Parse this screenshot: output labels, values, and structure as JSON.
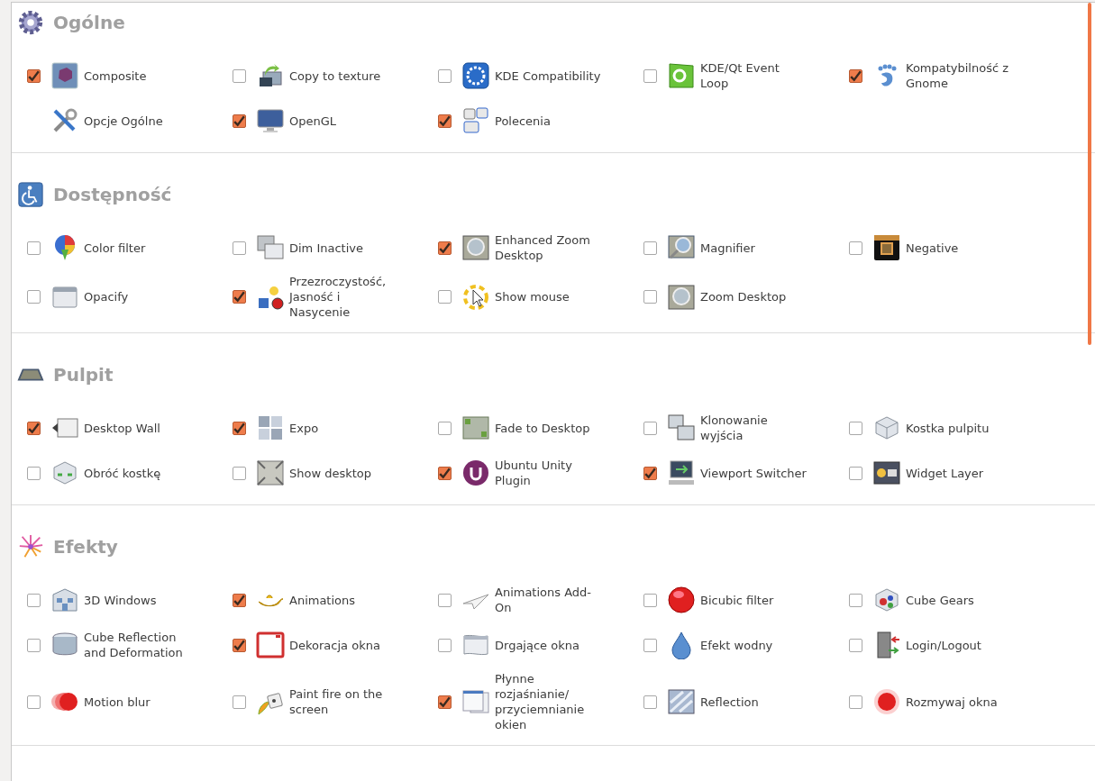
{
  "sections": [
    {
      "title": "Ogólne",
      "items": [
        {
          "label": "Composite",
          "checked": true
        },
        {
          "label": "Copy to texture",
          "checked": false
        },
        {
          "label": "KDE Compatibility",
          "checked": false
        },
        {
          "label": "KDE/Qt Event Loop",
          "checked": false
        },
        {
          "label": "Kompatybilność z Gnome",
          "checked": true
        },
        {
          "label": "Opcje Ogólne",
          "kind": "nobox"
        },
        {
          "label": "OpenGL",
          "checked": true
        },
        {
          "label": "Polecenia",
          "checked": true
        }
      ]
    },
    {
      "title": "Dostępność",
      "items": [
        {
          "label": "Color filter",
          "checked": false
        },
        {
          "label": "Dim Inactive",
          "checked": false
        },
        {
          "label": "Enhanced Zoom Desktop",
          "checked": true
        },
        {
          "label": "Magnifier",
          "checked": false
        },
        {
          "label": "Negative",
          "checked": false
        },
        {
          "label": "Opacify",
          "checked": false
        },
        {
          "label": "Przezroczystość, Jasność i Nasycenie",
          "checked": true
        },
        {
          "label": "Show mouse",
          "checked": false
        },
        {
          "label": "Zoom Desktop",
          "checked": false
        }
      ]
    },
    {
      "title": "Pulpit",
      "items": [
        {
          "label": "Desktop Wall",
          "checked": true
        },
        {
          "label": "Expo",
          "checked": true
        },
        {
          "label": "Fade to Desktop",
          "checked": false
        },
        {
          "label": "Klonowanie wyjścia",
          "checked": false
        },
        {
          "label": "Kostka pulpitu",
          "checked": false
        },
        {
          "label": "Obróć kostkę",
          "checked": false
        },
        {
          "label": "Show desktop",
          "checked": false
        },
        {
          "label": "Ubuntu Unity Plugin",
          "checked": true
        },
        {
          "label": "Viewport Switcher",
          "checked": true
        },
        {
          "label": "Widget Layer",
          "checked": false
        }
      ]
    },
    {
      "title": "Efekty",
      "items": [
        {
          "label": "3D Windows",
          "checked": false
        },
        {
          "label": "Animations",
          "checked": true
        },
        {
          "label": "Animations Add-On",
          "checked": false
        },
        {
          "label": "Bicubic filter",
          "checked": false
        },
        {
          "label": "Cube Gears",
          "checked": false
        },
        {
          "label": "Cube Reflection and Deformation",
          "checked": false
        },
        {
          "label": "Dekoracja okna",
          "checked": true
        },
        {
          "label": "Drgające okna",
          "checked": false
        },
        {
          "label": "Efekt wodny",
          "checked": false
        },
        {
          "label": "Login/Logout",
          "checked": false
        },
        {
          "label": "Motion blur",
          "checked": false
        },
        {
          "label": "Paint fire on the screen",
          "checked": false
        },
        {
          "label": "Płynne rozjaśnianie/ przyciemnianie okien",
          "checked": true
        },
        {
          "label": "Reflection",
          "checked": false
        },
        {
          "label": "Rozmywaj okna",
          "checked": false
        }
      ]
    }
  ]
}
